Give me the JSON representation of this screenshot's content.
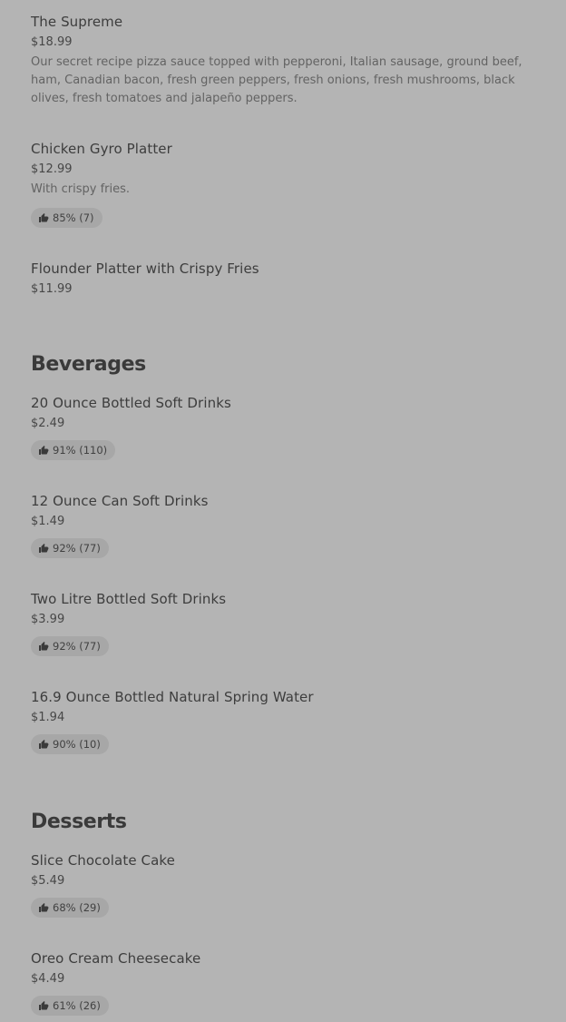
{
  "items": [
    {
      "name": "The Supreme",
      "price": "$18.99",
      "description": "Our secret recipe pizza sauce topped with pepperoni, Italian sausage, ground beef, ham, Canadian bacon, fresh green peppers, fresh onions, fresh mushrooms, black olives, fresh tomatoes and jalapeño peppers."
    },
    {
      "name": "Chicken Gyro Platter",
      "price": "$12.99",
      "description": "With crispy fries.",
      "rating": "85% (7)"
    },
    {
      "name": "Flounder Platter with Crispy Fries",
      "price": "$11.99"
    }
  ],
  "beverages": {
    "title": "Beverages",
    "items": [
      {
        "name": "20 Ounce Bottled Soft Drinks",
        "price": "$2.49",
        "rating": "91% (110)"
      },
      {
        "name": "12 Ounce Can Soft Drinks",
        "price": "$1.49",
        "rating": "92% (77)"
      },
      {
        "name": "Two Litre Bottled Soft Drinks",
        "price": "$3.99",
        "rating": "92% (77)"
      },
      {
        "name": "16.9 Ounce Bottled Natural Spring Water",
        "price": "$1.94",
        "rating": "90% (10)"
      }
    ]
  },
  "desserts": {
    "title": "Desserts",
    "items": [
      {
        "name": "Slice Chocolate Cake",
        "price": "$5.49",
        "rating": "68% (29)"
      },
      {
        "name": "Oreo Cream Cheesecake",
        "price": "$4.49",
        "rating": "61% (26)"
      }
    ]
  },
  "icons": {
    "rating": "thumbs-up-icon"
  },
  "colors": {
    "background": "#b4b4b4",
    "rating_pill": "#a7a7a7",
    "text": "#3a3a3a"
  }
}
